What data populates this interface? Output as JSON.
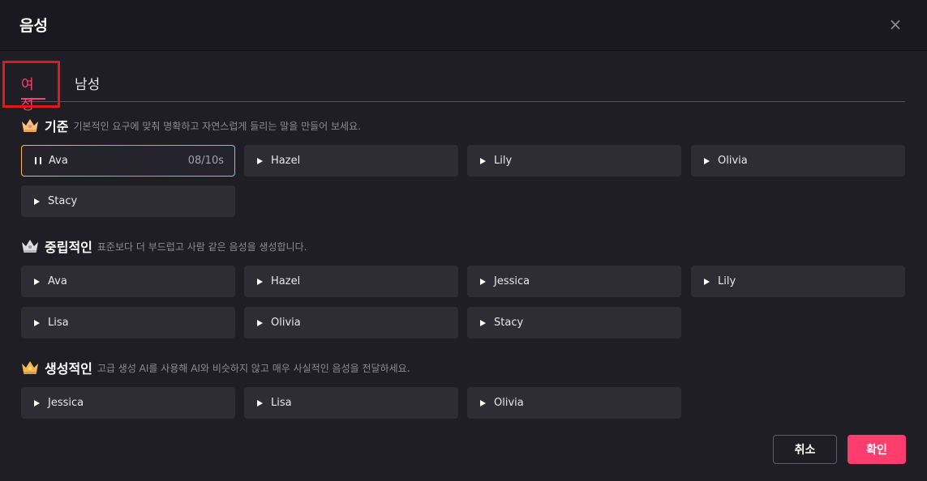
{
  "dialog": {
    "title": "음성",
    "close_glyph": "×"
  },
  "tabs": [
    {
      "label": "여성",
      "selected": true
    },
    {
      "label": "남성",
      "selected": false
    }
  ],
  "sections": [
    {
      "title": "기준",
      "description": "기본적인 요구에 맞춰 명확하고 자연스럽게 들리는 말을 만들어 보세요.",
      "icon": "crown-gold-icon",
      "voices": [
        {
          "name": "Ava",
          "state": "playing",
          "time": "08/10s"
        },
        {
          "name": "Hazel"
        },
        {
          "name": "Lily"
        },
        {
          "name": "Olivia"
        },
        {
          "name": "Stacy"
        }
      ]
    },
    {
      "title": "중립적인",
      "description": "표준보다 더 부드럽고 사람 같은 음성을 생성합니다.",
      "icon": "crown-silver-icon",
      "voices": [
        {
          "name": "Ava"
        },
        {
          "name": "Hazel"
        },
        {
          "name": "Jessica"
        },
        {
          "name": "Lily"
        },
        {
          "name": "Lisa"
        },
        {
          "name": "Olivia"
        },
        {
          "name": "Stacy"
        }
      ]
    },
    {
      "title": "생성적인",
      "description": "고급 생성 AI를 사용해 AI와 비슷하지 않고 매우 사실적인 음성을 전달하세요.",
      "icon": "crown-gold-icon",
      "voices": [
        {
          "name": "Jessica"
        },
        {
          "name": "Lisa"
        },
        {
          "name": "Olivia"
        }
      ]
    }
  ],
  "footer": {
    "cancel_label": "취소",
    "confirm_label": "확인"
  },
  "colors": {
    "accent": "#ff3c6e",
    "highlight_box": "#e3181d",
    "background": "#1f1e25",
    "button": "#2e2d36"
  }
}
